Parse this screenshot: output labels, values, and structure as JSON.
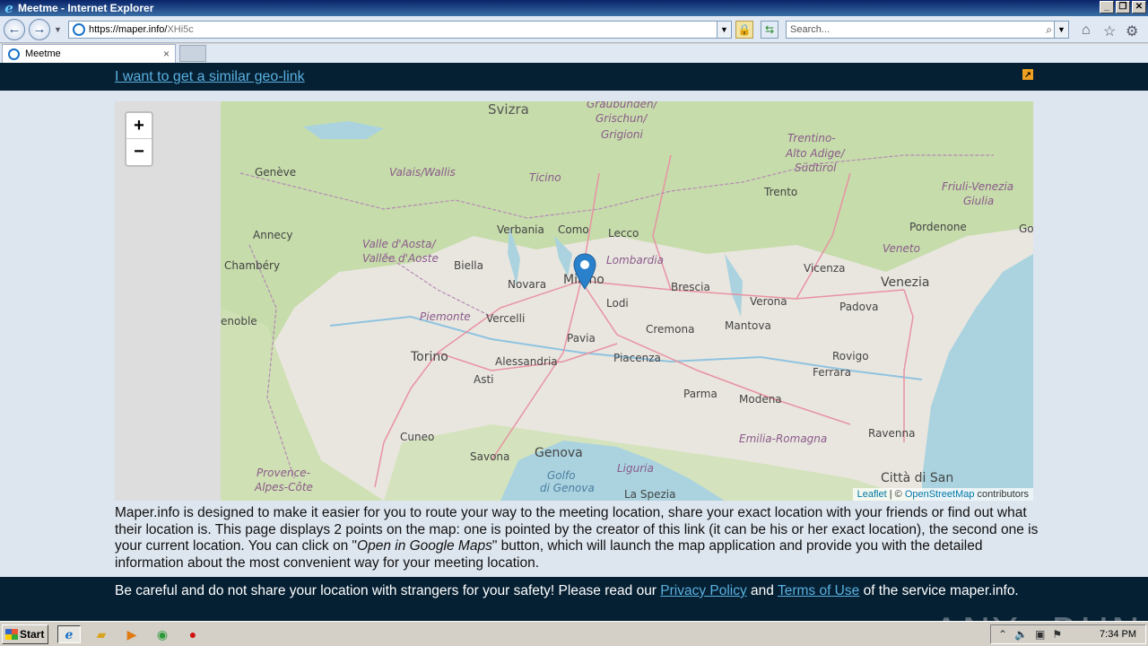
{
  "window": {
    "title": "Meetme - Internet Explorer",
    "buttons": {
      "minimize": "_",
      "restore": "❐",
      "close": "✕"
    }
  },
  "address_bar": {
    "url_host": "https://maper.info/",
    "url_path": "XHi5c",
    "search_placeholder": "Search..."
  },
  "tabs": [
    {
      "label": "Meetme",
      "close": "×"
    }
  ],
  "page": {
    "top_link": "I want to get a similar geo-link",
    "map": {
      "zoom_in": "+",
      "zoom_out": "−",
      "attribution": {
        "leaflet": "Leaflet",
        "separator": " | © ",
        "osm": "OpenStreetMap",
        "suffix": " contributors"
      },
      "places": {
        "svizzera": "Svizra",
        "graubunden": "Graubünden/",
        "grischun": "Grischun/",
        "grigioni": "Grigioni",
        "trentino": "Trentino-",
        "alto_adige": "Alto Adige/",
        "sudtirol": "Südtirol",
        "geneve": "Genève",
        "valais": "Valais/Wallis",
        "ticino": "Ticino",
        "trento": "Trento",
        "friuli": "Friuli-Venezia",
        "giulia": "Giulia",
        "annecy": "Annecy",
        "verbania": "Verbania",
        "como": "Como",
        "lecco": "Lecco",
        "pordenone": "Pordenone",
        "valle_aosta": "Valle d'Aosta/",
        "vallee_aoste": "Vallée d'Aoste",
        "veneto": "Veneto",
        "chambery": "Chambéry",
        "biella": "Biella",
        "lombardia": "Lombardia",
        "vicenza": "Vicenza",
        "venezia": "Venezia",
        "novara": "Novara",
        "milano": "Milano",
        "brescia": "Brescia",
        "verona": "Verona",
        "padova": "Padova",
        "grenoble": "enoble",
        "piemonte": "Piemonte",
        "vercelli": "Vercelli",
        "lodi": "Lodi",
        "mantova": "Mantova",
        "cremona": "Cremona",
        "pavia": "Pavia",
        "torino": "Torino",
        "alessandria": "Alessandria",
        "piacenza": "Piacenza",
        "rovigo": "Rovigo",
        "asti": "Asti",
        "ferrara": "Ferrara",
        "parma": "Parma",
        "modena": "Modena",
        "cuneo": "Cuneo",
        "emilia": "Emilia-Romagna",
        "ravenna": "Ravenna",
        "savona": "Savona",
        "genova": "Genova",
        "golfo": "Golfo",
        "di_genova": "di Genova",
        "liguria": "Liguria",
        "provence": "Provence-",
        "alpes": "Alpes-Côte",
        "la_spezia": "La Spezia",
        "citta_san": "Città di San",
        "go": "Go"
      }
    },
    "description": {
      "part1": "Maper.info is designed to make it easier for you to route your way to the meeting location, share your exact location with your friends or find out what their location is. This page displays 2 points on the map: one is pointed by the creator of this link (it can be his or her exact location), the second one is your current location. You can click on \"",
      "em": "Open in Google Maps",
      "part2": "\" button, which will launch the map application and provide you with the detailed information about the most convenient way for your meeting location."
    },
    "footer": {
      "part1": "Be careful and do not share your location with strangers for your safety! Please read our ",
      "privacy": "Privacy Policy",
      "and": " and ",
      "terms": "Terms of Use",
      "part2": " of the service maper.info."
    },
    "watermark": "ANY▷RUN"
  },
  "taskbar": {
    "start": "Start",
    "clock": "7:34 PM"
  }
}
